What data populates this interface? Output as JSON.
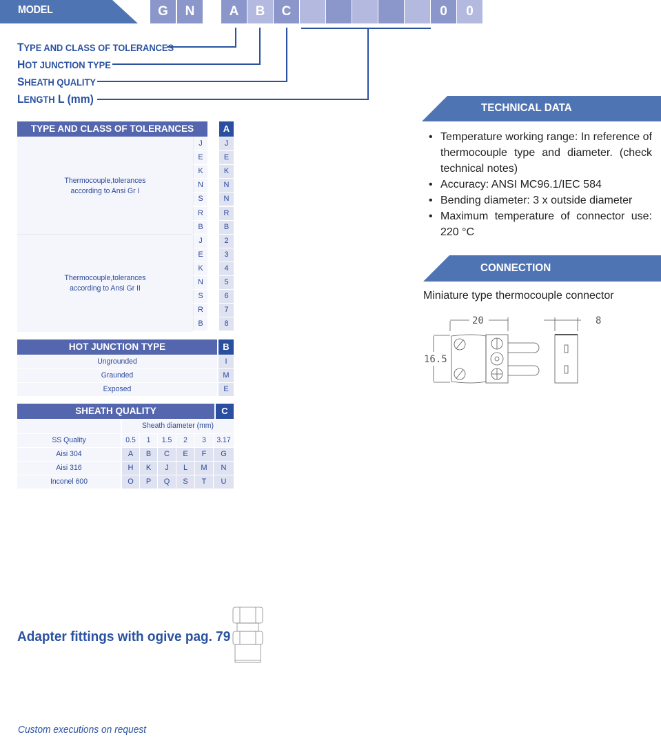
{
  "model": {
    "label": "MODEL",
    "code_boxes": [
      "G",
      "N",
      "A",
      "B",
      "C",
      "",
      "",
      "",
      "",
      "",
      "0",
      "0"
    ]
  },
  "legend": {
    "type_tolerances": {
      "first": "T",
      "rest": "YPE AND CLASS OF TOLERANCES"
    },
    "hot_junction": {
      "first": "H",
      "rest": "OT JUNCTION TYPE"
    },
    "sheath_quality": {
      "first": "S",
      "rest": "HEATH QUALITY"
    },
    "length": {
      "first": "L",
      "rest": "ENGTH",
      "suffix": " L (mm)"
    }
  },
  "table_tolerances": {
    "title": "TYPE AND CLASS OF TOLERANCES",
    "code": "A",
    "groups": [
      {
        "description_line1": "Thermocouple,tolerances",
        "description_line2": "according to Ansi Gr I",
        "rows": [
          {
            "type": "J",
            "code": "J"
          },
          {
            "type": "E",
            "code": "E"
          },
          {
            "type": "K",
            "code": "K"
          },
          {
            "type": "N",
            "code": "N"
          },
          {
            "type": "S",
            "code": "N"
          },
          {
            "type": "R",
            "code": "R"
          },
          {
            "type": "B",
            "code": "B"
          }
        ]
      },
      {
        "description_line1": "Thermocouple,tolerances",
        "description_line2": "according to Ansi Gr II",
        "rows": [
          {
            "type": "J",
            "code": "2"
          },
          {
            "type": "E",
            "code": "3"
          },
          {
            "type": "K",
            "code": "4"
          },
          {
            "type": "N",
            "code": "5"
          },
          {
            "type": "S",
            "code": "6"
          },
          {
            "type": "R",
            "code": "7"
          },
          {
            "type": "B",
            "code": "8"
          }
        ]
      }
    ]
  },
  "table_hot_junction": {
    "title": "HOT JUNCTION TYPE",
    "code": "B",
    "rows": [
      {
        "label": "Ungrounded",
        "code": "I"
      },
      {
        "label": "Graunded",
        "code": "M"
      },
      {
        "label": "Exposed",
        "code": "E"
      }
    ]
  },
  "table_sheath": {
    "title": "SHEATH QUALITY",
    "code": "C",
    "diameter_header": "Sheath diameter (mm)",
    "row_header": "SS Quality",
    "diameters": [
      "0.5",
      "1",
      "1.5",
      "2",
      "3",
      "3.17"
    ],
    "rows": [
      {
        "label": "Aisi 304",
        "codes": [
          "A",
          "B",
          "C",
          "E",
          "F",
          "G"
        ]
      },
      {
        "label": "Aisi 316",
        "codes": [
          "H",
          "K",
          "J",
          "L",
          "M",
          "N"
        ]
      },
      {
        "label": "Inconel 600",
        "codes": [
          "O",
          "P",
          "Q",
          "S",
          "T",
          "U"
        ]
      }
    ]
  },
  "technical_data": {
    "title": "TECHNICAL DATA",
    "items": [
      "Temperature working range: In reference of thermocouple type and diameter. (check technical notes)",
      "Accuracy: ANSI MC96.1/IEC 584",
      "Bending diameter: 3 x outside diameter",
      "Maximum temperature of connector use: 220 °C"
    ]
  },
  "connection": {
    "title": "CONNECTION",
    "description": "Miniature type thermocouple connector",
    "drawing": {
      "width_dim": "20",
      "height_dim": "16.5",
      "depth_dim": "8"
    }
  },
  "adapter": {
    "text": "Adapter fittings with ogive pag. 79"
  },
  "footer": {
    "custom": "Custom executions on request"
  }
}
